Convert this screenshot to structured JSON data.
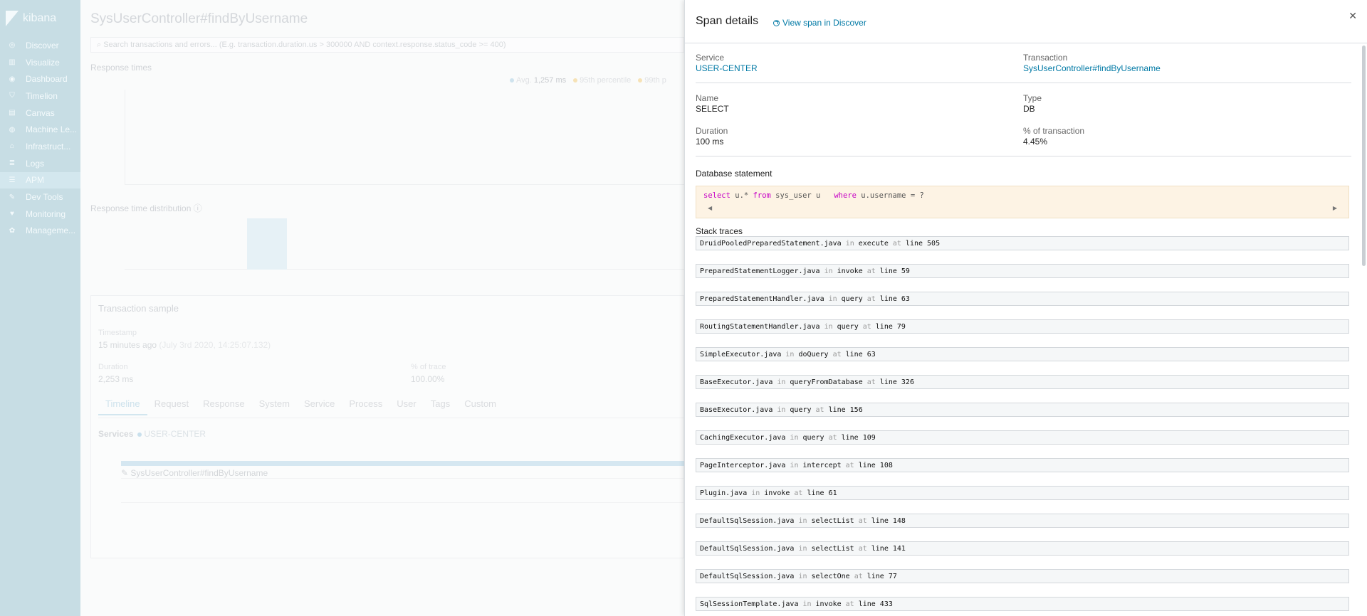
{
  "sidebar": {
    "brand": "kibana",
    "items": [
      {
        "label": "Discover",
        "icon": "compass-icon"
      },
      {
        "label": "Visualize",
        "icon": "bar-chart-icon"
      },
      {
        "label": "Dashboard",
        "icon": "dashboard-icon"
      },
      {
        "label": "Timelion",
        "icon": "shield-icon"
      },
      {
        "label": "Canvas",
        "icon": "canvas-icon"
      },
      {
        "label": "Machine Le...",
        "icon": "ml-icon"
      },
      {
        "label": "Infrastruct...",
        "icon": "infra-icon"
      },
      {
        "label": "Logs",
        "icon": "logs-icon"
      },
      {
        "label": "APM",
        "icon": "apm-icon",
        "active": true
      },
      {
        "label": "Dev Tools",
        "icon": "wrench-icon"
      },
      {
        "label": "Monitoring",
        "icon": "heartbeat-icon"
      },
      {
        "label": "Manageme...",
        "icon": "gear-icon"
      }
    ]
  },
  "page": {
    "title": "SysUserController#findByUsername",
    "search_placeholder": "Search transactions and errors... (E.g. transaction.duration.us > 300000 AND context.response.status_code >= 400)",
    "response_times_label": "Response times",
    "legend": {
      "avg_label": "Avg.",
      "avg_value": "1,257 ms",
      "p95": "95th percentile",
      "p99": "99th p"
    },
    "distribution_label": "Response time distribution",
    "sample": {
      "title": "Transaction sample",
      "timestamp_label": "Timestamp",
      "timestamp_value": "15 minutes ago",
      "timestamp_detail": "(July 3rd 2020, 14:25:07.132)",
      "duration_label": "Duration",
      "duration_value": "2,253 ms",
      "pct_trace_label": "% of trace",
      "pct_trace_value": "100.00%",
      "tabs": [
        "Timeline",
        "Request",
        "Response",
        "System",
        "Service",
        "Process",
        "User",
        "Tags",
        "Custom"
      ],
      "services_label": "Services",
      "service_name": "USER-CENTER",
      "timeline_transaction": "SysUserController#findByUsername"
    }
  },
  "flyout": {
    "title": "Span details",
    "discover_link": "View span in Discover",
    "service_label": "Service",
    "service_value": "USER-CENTER",
    "transaction_label": "Transaction",
    "transaction_value": "SysUserController#findByUsername",
    "name_label": "Name",
    "name_value": "SELECT",
    "type_label": "Type",
    "type_value": "DB",
    "duration_label": "Duration",
    "duration_value": "100 ms",
    "pct_label": "% of transaction",
    "pct_value": "4.45%",
    "db_statement_label": "Database statement",
    "db_statement": {
      "kw1": "select",
      "part1": " u.* ",
      "kw2": "from",
      "part2": " sys_user u   ",
      "kw3": "where",
      "part3": " u.username = ?"
    },
    "stack_traces_label": "Stack traces",
    "stack_in": "in",
    "stack_at": "at",
    "stack_traces": [
      {
        "file": "DruidPooledPreparedStatement.java",
        "fn": "execute",
        "line": "line 505"
      },
      {
        "file": "PreparedStatementLogger.java",
        "fn": "invoke",
        "line": "line 59"
      },
      {
        "file": "PreparedStatementHandler.java",
        "fn": "query",
        "line": "line 63"
      },
      {
        "file": "RoutingStatementHandler.java",
        "fn": "query",
        "line": "line 79"
      },
      {
        "file": "SimpleExecutor.java",
        "fn": "doQuery",
        "line": "line 63"
      },
      {
        "file": "BaseExecutor.java",
        "fn": "queryFromDatabase",
        "line": "line 326"
      },
      {
        "file": "BaseExecutor.java",
        "fn": "query",
        "line": "line 156"
      },
      {
        "file": "CachingExecutor.java",
        "fn": "query",
        "line": "line 109"
      },
      {
        "file": "PageInterceptor.java",
        "fn": "intercept",
        "line": "line 108"
      },
      {
        "file": "Plugin.java",
        "fn": "invoke",
        "line": "line 61"
      },
      {
        "file": "DefaultSqlSession.java",
        "fn": "selectList",
        "line": "line 148"
      },
      {
        "file": "DefaultSqlSession.java",
        "fn": "selectList",
        "line": "line 141"
      },
      {
        "file": "DefaultSqlSession.java",
        "fn": "selectOne",
        "line": "line 77"
      },
      {
        "file": "SqlSessionTemplate.java",
        "fn": "invoke",
        "line": "line 433"
      }
    ]
  },
  "colors": {
    "sidebar": "#c7dde4",
    "link": "#0079a5",
    "code_bg": "#fdf3e4",
    "keyword": "#c600c6"
  }
}
